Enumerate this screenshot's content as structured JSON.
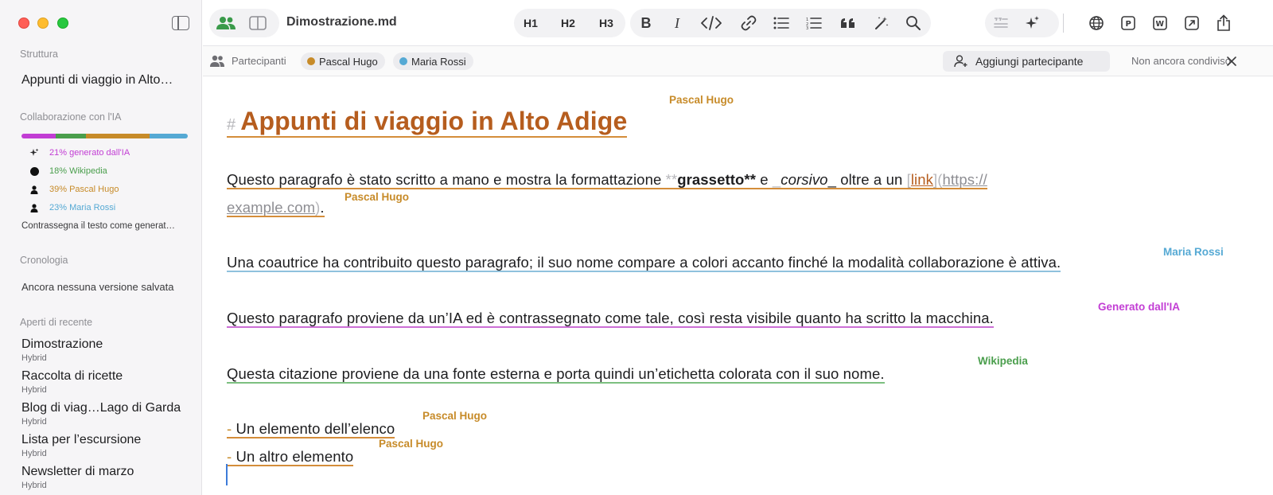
{
  "window": {
    "doc_title": "Dimostrazione.md"
  },
  "sidebar": {
    "structure_head": "Struttura",
    "outline_item": "Appunti di viaggio in Alto…",
    "ai_head": "Collaborazione con l'IA",
    "ai_stats": [
      {
        "label": "21% generato dall'IA",
        "percent": 21,
        "color": "#c23dd4",
        "icon": "sparkle-icon"
      },
      {
        "label": "18% Wikipedia",
        "percent": 18,
        "color": "#4a9e4c",
        "icon": "circle-icon"
      },
      {
        "label": "39% Pascal Hugo",
        "percent": 39,
        "color": "#c78b29",
        "icon": "person-icon"
      },
      {
        "label": "23% Maria Rossi",
        "percent": 23,
        "color": "#55a9d4",
        "icon": "person-icon"
      }
    ],
    "mark_ai_text": "Contrassegna il testo come generat…",
    "history_head": "Cronologia",
    "history_empty": "Ancora nessuna versione salvata",
    "recent_head": "Aperti di recente",
    "recent": [
      {
        "name": "Dimostrazione",
        "kind": "Hybrid"
      },
      {
        "name": "Raccolta di ricette",
        "kind": "Hybrid"
      },
      {
        "name": "Blog di viag…Lago di Garda",
        "kind": "Hybrid"
      },
      {
        "name": "Lista per l’escursione",
        "kind": "Hybrid"
      },
      {
        "name": "Newsletter di marzo",
        "kind": "Hybrid"
      }
    ]
  },
  "toolbar": {
    "h1": "H1",
    "h2": "H2",
    "h3": "H3",
    "bold": "B",
    "italic": "I"
  },
  "participants": {
    "label": "Partecipanti",
    "people": [
      {
        "name": "Pascal Hugo",
        "color": "#c78b29"
      },
      {
        "name": "Maria Rossi",
        "color": "#55a9d4"
      }
    ],
    "add_label": "Aggiungi partecipante",
    "share_status": "Non ancora condiviso"
  },
  "document": {
    "heading_marker": "#",
    "heading": "Appunti di viaggio in Alto Adige",
    "heading_author": "Pascal Hugo",
    "p1": {
      "a": "Questo paragrafo è stato scritto a mano e mostra la formattazione ",
      "bold_open": "**",
      "bold": "grassetto",
      "bold_close": "**",
      "b": " e ",
      "italic_open": "_",
      "italic": "corsivo",
      "italic_close": "_",
      "c": " oltre a un ",
      "lb_open": "[",
      "link": "link",
      "lb_close": "]",
      "paren_open": "(",
      "url1": "https://",
      "url2": "example.com",
      "paren_close": ")",
      "end": ".",
      "author": "Pascal Hugo"
    },
    "p2": {
      "text": "Una coautrice ha contribuito questo paragrafo; il suo nome compare a colori accanto finché la modalità collaborazione è attiva.",
      "author": "Maria Rossi"
    },
    "p3": {
      "text": "Questo paragrafo proviene da un’IA ed è contrassegnato come tale, così resta visibile quanto ha scritto la macchina.",
      "author": "Generato dall'IA"
    },
    "p4": {
      "text": "Questa citazione proviene da una fonte esterna e porta quindi un’etichetta colorata con il suo nome.",
      "author": "Wikipedia"
    },
    "list": [
      {
        "marker": "-",
        "text": " Un elemento dell’elenco",
        "author": "Pascal Hugo"
      },
      {
        "marker": "-",
        "text": " Un altro elemento",
        "author": "Pascal Hugo"
      }
    ]
  }
}
